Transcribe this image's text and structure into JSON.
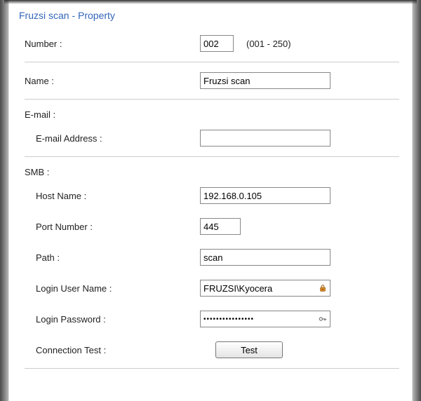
{
  "title": "Fruzsi scan - Property",
  "number": {
    "label": "Number :",
    "value": "002",
    "hint": "(001 - 250)"
  },
  "name": {
    "label": "Name :",
    "value": "Fruzsi scan"
  },
  "email": {
    "section": "E-mail :",
    "address_label": "E-mail Address :",
    "address_value": ""
  },
  "smb": {
    "section": "SMB :",
    "host_label": "Host Name :",
    "host_value": "192.168.0.105",
    "port_label": "Port Number :",
    "port_value": "445",
    "path_label": "Path :",
    "path_value": "scan",
    "user_label": "Login User Name :",
    "user_value": "FRUZSI\\Kyocera",
    "pass_label": "Login Password :",
    "pass_value": "••••••••••••••••",
    "conn_label": "Connection Test :",
    "conn_button": "Test"
  }
}
